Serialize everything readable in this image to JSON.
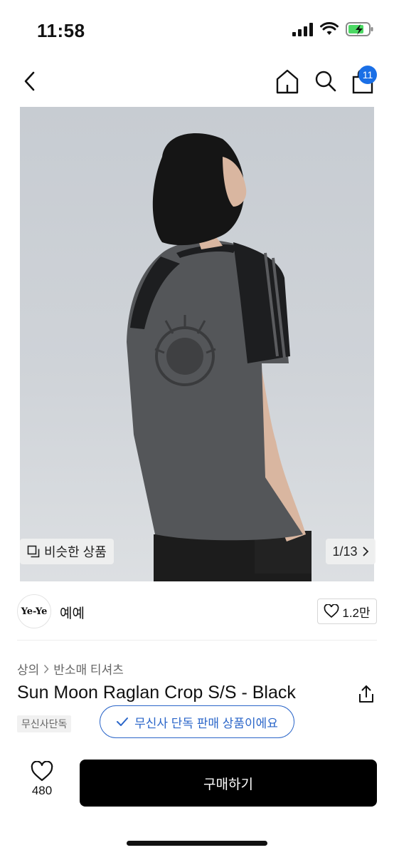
{
  "status_bar": {
    "time": "11:58"
  },
  "nav": {
    "cart_count": "11"
  },
  "gallery": {
    "similar_label": "비슷한 상품",
    "counter": "1/13"
  },
  "brand": {
    "logo_text": "Ye-Ye",
    "name": "예예",
    "likes": "1.2만"
  },
  "breadcrumb": {
    "category": "상의",
    "subcategory": "반소매 티셔츠"
  },
  "product": {
    "title": "Sun Moon Raglan Crop S/S - Black",
    "exclusive_tag": "무신사단독",
    "exclusive_notice": "무신사 단독 판매 상품이에요"
  },
  "bottom_bar": {
    "like_count": "480",
    "buy_label": "구매하기"
  },
  "colors": {
    "accent": "#1a6fe6",
    "notice_blue": "#2b66c9",
    "buy_bg": "#000000"
  },
  "icons": [
    "back-icon",
    "home-icon",
    "search-icon",
    "shopping-bag-icon",
    "heart-icon",
    "share-icon",
    "check-icon",
    "chevron-right-icon",
    "similar-icon"
  ]
}
